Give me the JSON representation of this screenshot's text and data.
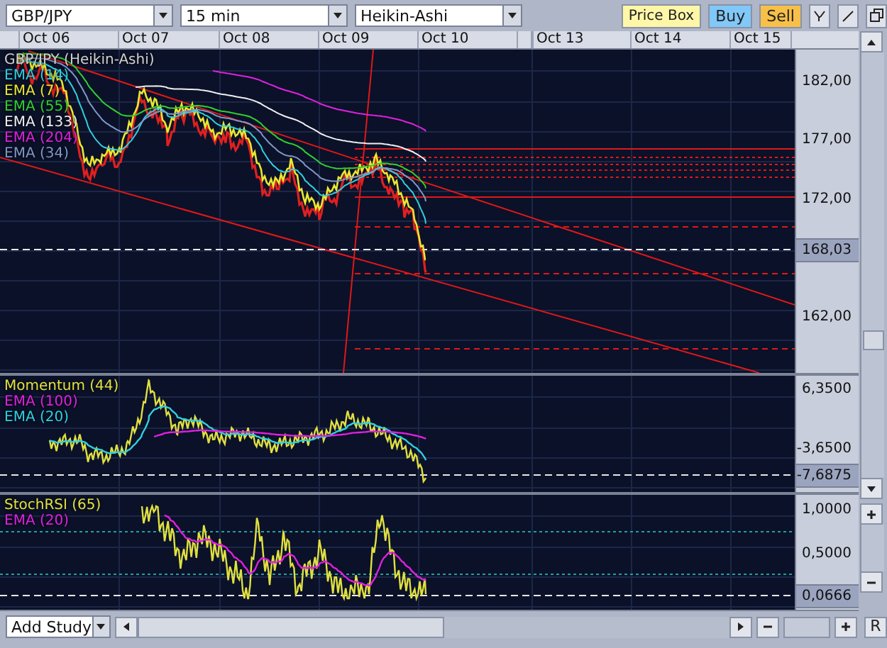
{
  "toolbar": {
    "symbol": "GBP/JPY",
    "interval": "15 min",
    "chart_type": "Heikin-Ashi",
    "buttons": [
      {
        "label": "Price Box",
        "kind": "pricebox"
      },
      {
        "label": "Buy",
        "kind": "buy"
      },
      {
        "label": "Sell",
        "kind": "sell"
      }
    ]
  },
  "dates": [
    {
      "label": "Oct 06",
      "gap_before": false
    },
    {
      "label": "Oct 07",
      "gap_before": false
    },
    {
      "label": "Oct 08",
      "gap_before": false
    },
    {
      "label": "Oct 09",
      "gap_before": false
    },
    {
      "label": "Oct 10",
      "gap_before": false
    },
    {
      "label": "Oct 13",
      "gap_before": true
    },
    {
      "label": "Oct 14",
      "gap_before": false
    },
    {
      "label": "Oct 15",
      "gap_before": false
    }
  ],
  "panes": [
    {
      "kind": "price",
      "legend": [
        {
          "label": "GBP/JPY (Heikin-Ashi)",
          "color": "#d0d0d0"
        },
        {
          "label": "EMA (14)",
          "color": "#30d0e0"
        },
        {
          "label": "EMA (7)",
          "color": "#e8e830"
        },
        {
          "label": "EMA (55)",
          "color": "#30d030"
        },
        {
          "label": "EMA (133)",
          "color": "#f0f0f0"
        },
        {
          "label": "EMA (204)",
          "color": "#e020e0"
        },
        {
          "label": "EMA (34)",
          "color": "#8098c8"
        }
      ],
      "axis_labels": [
        "182,00",
        "177,00",
        "172,00",
        "162,00"
      ],
      "price_tag": "168,03"
    },
    {
      "kind": "momentum",
      "legend": [
        {
          "label": "Momentum (44)",
          "color": "#e0e040"
        },
        {
          "label": "EMA (100)",
          "color": "#e020e0"
        },
        {
          "label": "EMA (20)",
          "color": "#30d0e0"
        }
      ],
      "axis_labels": [
        "6,3500",
        "-3,6500"
      ],
      "price_tag": "-7,6875"
    },
    {
      "kind": "stoch",
      "legend": [
        {
          "label": "StochRSI (65)",
          "color": "#e0e040"
        },
        {
          "label": "EMA (20)",
          "color": "#e020e0"
        }
      ],
      "axis_labels": [
        "1,0000",
        "0,5000"
      ],
      "price_tag": "0,0666"
    }
  ],
  "bottom": {
    "study_select": "Add Study",
    "reset_label": "R"
  }
}
